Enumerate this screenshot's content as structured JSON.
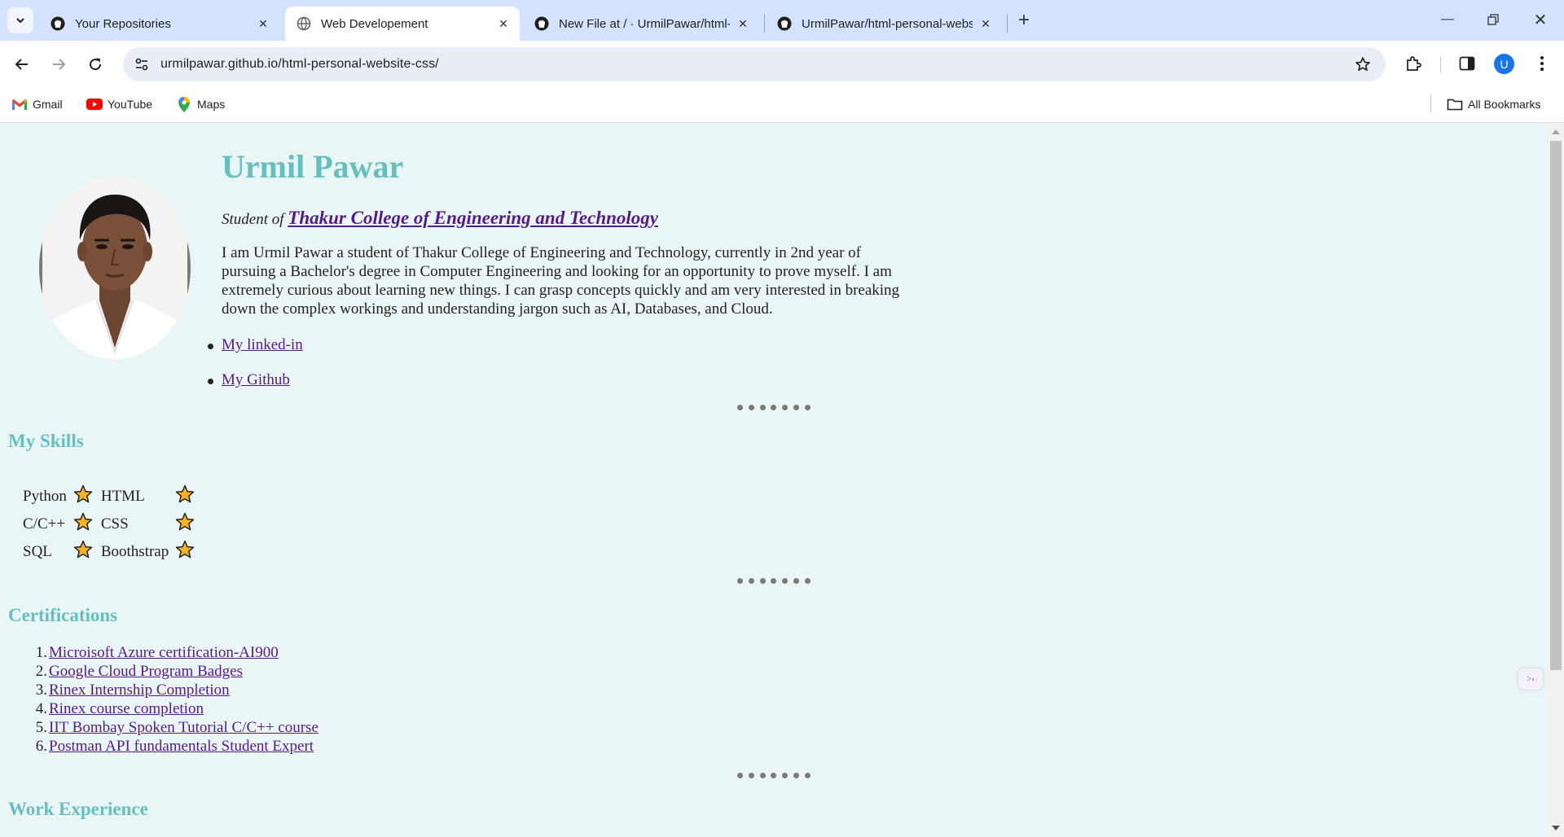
{
  "browser": {
    "tabs": [
      {
        "title": "Your Repositories",
        "icon": "github-icon",
        "active": false
      },
      {
        "title": "Web Developement",
        "icon": "globe-icon",
        "active": true
      },
      {
        "title": "New File at / · UrmilPawar/html-personal-website-css",
        "icon": "github-icon",
        "active": false
      },
      {
        "title": "UrmilPawar/html-personal-website-css",
        "icon": "github-icon",
        "active": false
      }
    ],
    "url": "urmilpawar.github.io/html-personal-website-css/",
    "profile_initial": "U",
    "bookmarks": [
      {
        "label": "Gmail",
        "icon": "gmail-icon"
      },
      {
        "label": "YouTube",
        "icon": "youtube-icon"
      },
      {
        "label": "Maps",
        "icon": "maps-icon"
      }
    ],
    "all_bookmarks_label": "All Bookmarks"
  },
  "page": {
    "name": "Urmil Pawar",
    "subtitle_prefix": "Student of",
    "college": "Thakur College of Engineering and Technology",
    "bio": "I am Urmil Pawar a student of Thakur College of Engineering and Technology, currently in 2nd year of pursuing a Bachelor's degree in Computer Engineering and looking for an opportunity to prove myself. I am extremely curious about learning new things. I can grasp concepts quickly and am very interested in breaking down the complex workings and understanding jargon such as AI, Databases, and Cloud.",
    "links": [
      "My linked-in",
      "My Github"
    ],
    "skills_title": "My Skills",
    "skills": [
      [
        "Python",
        "HTML"
      ],
      [
        "C/C++",
        "CSS"
      ],
      [
        "SQL",
        "Boothstrap"
      ]
    ],
    "certifications_title": "Certifications",
    "certifications": [
      {
        "num": "1.",
        "label": "Microisoft Azure certification-AI900"
      },
      {
        "num": "2.",
        "label": "Google Cloud Program Badges"
      },
      {
        "num": "3.",
        "label": "Rinex Internship Completion"
      },
      {
        "num": "4.",
        "label": "Rinex course completion"
      },
      {
        "num": "5.",
        "label": "IIT Bombay Spoken Tutorial C/C++ course"
      },
      {
        "num": "6.",
        "label": "Postman API fundamentals Student Expert"
      }
    ],
    "work_title": "Work Experience"
  },
  "colors": {
    "heading": "#66bfbf",
    "background": "#eaf6f6",
    "link": "#551a8b",
    "star": "#f5b324"
  }
}
